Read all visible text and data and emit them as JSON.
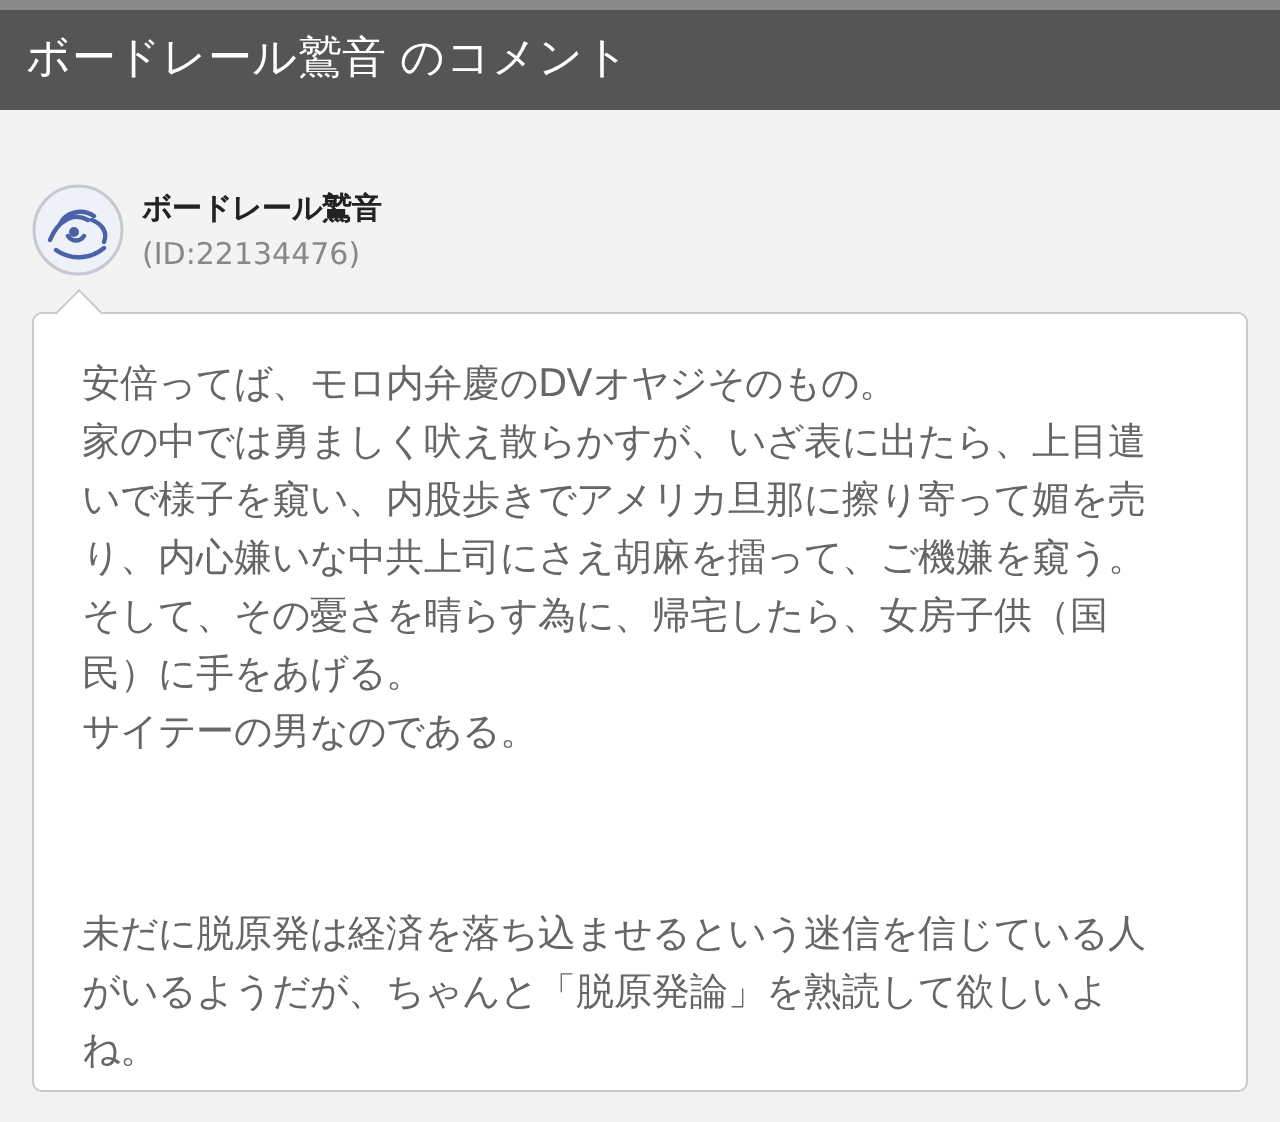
{
  "header": {
    "title": "ボードレール鷲音 のコメント"
  },
  "comment": {
    "author": "ボードレール鷲音",
    "user_id": "(ID:22134476)",
    "paragraphs": [
      [
        "安倍ってば、モロ内弁慶のDVオヤジそのもの。",
        "家の中では勇ましく吠え散らかすが、いざ表に出たら、上目遣いで様子を窺い、内股歩きでアメリカ旦那に擦り寄って媚を売り、内心嫌いな中共上司にさえ胡麻を擂って、ご機嫌を窺う。",
        "そして、その憂さを晴らす為に、帰宅したら、女房子供（国民）に手をあげる。",
        "サイテーの男なのである。"
      ],
      [
        "未だに脱原発は経済を落ち込ませるという迷信を信じている人がいるようだが、ちゃんと「脱原発論」を熟読して欲しいよね。"
      ]
    ]
  }
}
